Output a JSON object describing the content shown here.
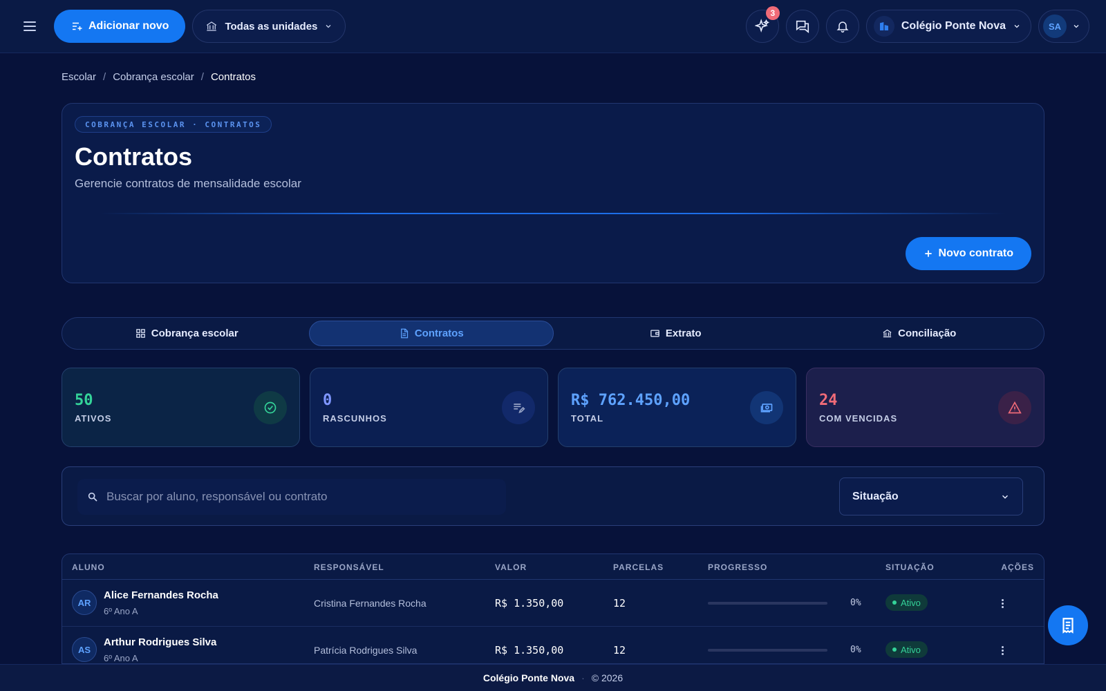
{
  "topbar": {
    "add_new_label": "Adicionar novo",
    "units_label": "Todas as unidades",
    "ai_badge": "3",
    "school_name": "Colégio Ponte Nova",
    "user_initials": "SA"
  },
  "breadcrumb": [
    "Escolar",
    "Cobrança escolar",
    "Contratos"
  ],
  "hero": {
    "tag": "COBRANÇA ESCOLAR · CONTRATOS",
    "title": "Contratos",
    "subtitle": "Gerencie contratos de mensalidade escolar",
    "new_contract_label": "Novo contrato"
  },
  "tabs": [
    {
      "label": "Cobrança escolar",
      "icon": "grid-icon",
      "active": false
    },
    {
      "label": "Contratos",
      "icon": "document-icon",
      "active": true
    },
    {
      "label": "Extrato",
      "icon": "wallet-icon",
      "active": false
    },
    {
      "label": "Conciliação",
      "icon": "bank-icon",
      "active": false
    }
  ],
  "stats": [
    {
      "value": "50",
      "label": "ATIVOS",
      "color": "#34d399",
      "icon": "check-circle-icon"
    },
    {
      "value": "0",
      "label": "RASCUNHOS",
      "color": "#7f96ff",
      "icon": "edit-list-icon"
    },
    {
      "value": "R$ 762.450,00",
      "label": "TOTAL",
      "color": "#5ea2ff",
      "icon": "money-icon"
    },
    {
      "value": "24",
      "label": "COM VENCIDAS",
      "color": "#f06b78",
      "icon": "warning-icon"
    }
  ],
  "filter": {
    "search_placeholder": "Buscar por aluno, responsável ou contrato",
    "status_select": "Situação"
  },
  "table": {
    "headers": [
      "ALUNO",
      "RESPONSÁVEL",
      "VALOR",
      "PARCELAS",
      "PROGRESSO",
      "SITUAÇÃO",
      "AÇÕES"
    ],
    "rows": [
      {
        "initials": "AR",
        "name": "Alice Fernandes Rocha",
        "class": "6º Ano A",
        "guardian": "Cristina Fernandes Rocha",
        "value": "R$ 1.350,00",
        "installments": "12",
        "progress": "0%",
        "status": "Ativo"
      },
      {
        "initials": "AS",
        "name": "Arthur Rodrigues Silva",
        "class": "6º Ano A",
        "guardian": "Patrícia Rodrigues Silva",
        "value": "R$ 1.350,00",
        "installments": "12",
        "progress": "0%",
        "status": "Ativo"
      }
    ]
  },
  "footer": {
    "brand": "Colégio Ponte Nova",
    "copyright": "© 2026"
  }
}
